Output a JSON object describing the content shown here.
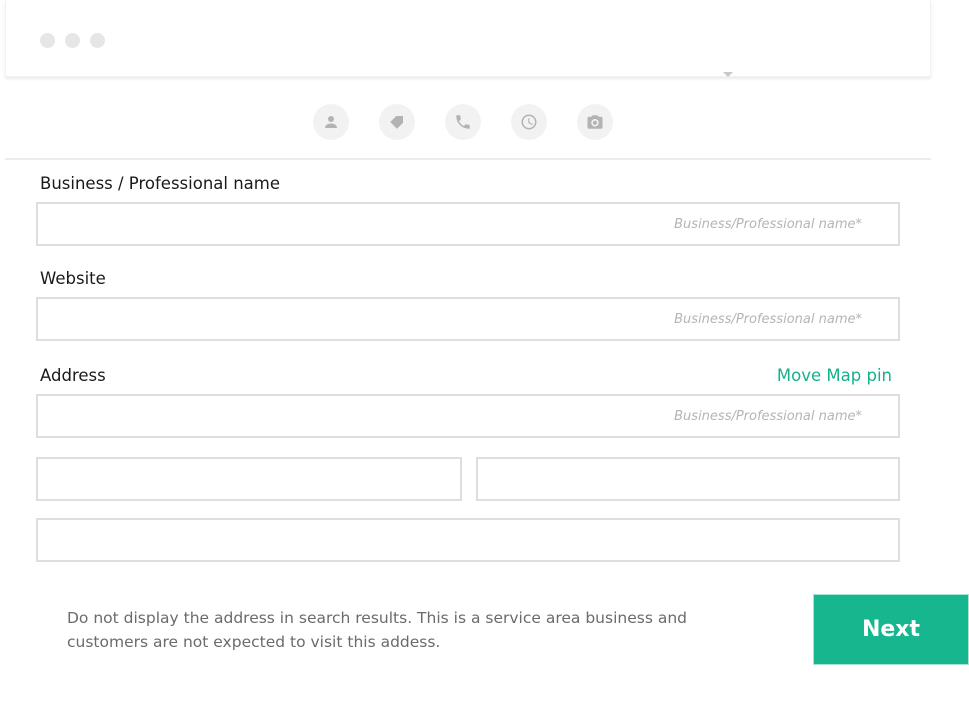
{
  "window": {
    "controls": [
      "window-dot",
      "window-dot",
      "window-dot"
    ],
    "caret_icon": "caret-down-icon"
  },
  "steps": [
    {
      "icon": "person-icon",
      "label": "Profile"
    },
    {
      "icon": "tag-icon",
      "label": "Category"
    },
    {
      "icon": "phone-icon",
      "label": "Contact"
    },
    {
      "icon": "clock-icon",
      "label": "Hours"
    },
    {
      "icon": "camera-icon",
      "label": "Photos"
    }
  ],
  "form": {
    "name_label": "Business / Professional name",
    "name_placeholder": "Business/Professional name*",
    "name_value": "",
    "website_label": "Website",
    "website_placeholder": "Business/Professional name*",
    "website_value": "",
    "address_label": "Address",
    "move_pin_link": "Move Map pin",
    "address_placeholder": "Business/Professional name*",
    "address_value": "",
    "city_value": "",
    "state_value": "",
    "zip_value": ""
  },
  "footer": {
    "note": "Do not display the address in search results. This is a service area business and customers are not expected to visit this addess.",
    "next_label": "Next"
  },
  "colors": {
    "accent": "#16b68f",
    "link": "#16b08d",
    "icon_bg": "#f2f2f2",
    "icon_fg": "#b3b3b3",
    "border": "#dedede"
  }
}
